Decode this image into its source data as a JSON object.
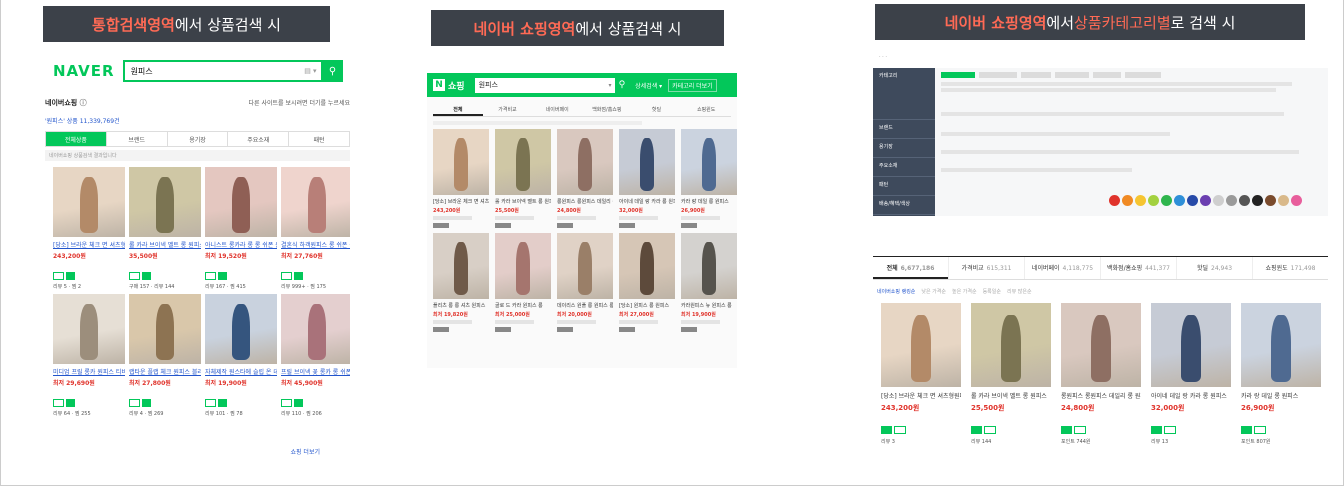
{
  "banners": [
    {
      "highlight1": "통합검색영역",
      "rest1": "에서 상품검색 시",
      "highlight2": "",
      "rest2": ""
    },
    {
      "highlight1": "네이버 쇼핑영역",
      "rest1": "에서 상품검색 시",
      "highlight2": "",
      "rest2": ""
    },
    {
      "highlight1": "네이버 쇼핑영역",
      "rest1": "에서 ",
      "highlight2": "상품카테고리별",
      "rest2": "로 검색 시"
    }
  ],
  "colors": {
    "naver_green": "#03c75a",
    "banner_bg": "#3c4149",
    "highlight": "#ff6a55",
    "price_red": "#e0332b"
  },
  "p1": {
    "logo": "NAVER",
    "query": "원피스",
    "section": "네이버쇼핑",
    "section_tip": "다른 사이트를 보시려면 더기를 누르세요",
    "result_count": "'원피스' 상품 11,339,769건",
    "tabs": [
      "전체상품",
      "브랜드",
      "용기장",
      "주요소재",
      "패턴"
    ],
    "notice": "네이버쇼핑 상품검색 결과입니다",
    "more": "쇼핑 더보기",
    "products": [
      {
        "title": "[당소] 브라운 체크 면 셔츠형원피...",
        "price": "243,200원",
        "meta": "리뷰 5 · 찜 2",
        "c1": "#e7d6c4",
        "c2": "#b38a68"
      },
      {
        "title": "롤 카라 브이넥 벨트 롱 원피스",
        "price": "35,500원",
        "meta": "구매 157 · 리뷰 144",
        "c1": "#cfc7a5",
        "c2": "#7b7452"
      },
      {
        "title": "아니스트 롱카라 롱 롱 쉬폰 원피...",
        "price": "최저 19,520원",
        "meta": "리뷰 167 · 찜 415",
        "c1": "#e4c7c0",
        "c2": "#8f5f55"
      },
      {
        "title": "결혼식 하객원피스 롱 쉬폰 롱 롱 원...",
        "price": "최저 27,760원",
        "meta": "리뷰 999+ · 찜 175",
        "c1": "#efd4cd",
        "c2": "#b87f78"
      },
      {
        "title": "미디엄 프릴 롱카 원피스 티비...",
        "price": "최저 29,690원",
        "meta": "리뷰 64 · 찜 255",
        "c1": "#e6dfd5",
        "c2": "#9c8e7c"
      },
      {
        "title": "랩타운 플랩 체크 원피스 블라...",
        "price": "최저 27,800원",
        "meta": "리뷰 4 · 찜 269",
        "c1": "#d9c7aa",
        "c2": "#8d7352"
      },
      {
        "title": "자체제작 원스타에 슬립 온 데비...",
        "price": "최저 19,900원",
        "meta": "리뷰 101 · 찜 78",
        "c1": "#c9d2de",
        "c2": "#35557e"
      },
      {
        "title": "프릴 브이넥 꽃 롱카 롱 쉬폰 미니...",
        "price": "최저 45,900원",
        "meta": "리뷰 110 · 찜 206",
        "c1": "#e4cfcf",
        "c2": "#a9727a"
      }
    ]
  },
  "p2": {
    "logo_n": "N",
    "logo_text": "쇼핑",
    "query": "원피스",
    "menu": "상세검색 ▾",
    "category_btn": "카테고리 더보기",
    "tabs": [
      "전체",
      "가격비교",
      "네이버페이",
      "백화점/홈쇼핑",
      "핫딜",
      "쇼핑윈도"
    ],
    "products": [
      {
        "title": "[당소] 브라운 체크 면 셔츠형원피스",
        "price": "243,200원",
        "c1": "#e7d6c4",
        "c2": "#b38a68"
      },
      {
        "title": "롤 카라 브이넥 벨트 롱 원피스",
        "price": "25,500원",
        "c1": "#cfc7a5",
        "c2": "#7b7452"
      },
      {
        "title": "롱원피스 롱원피스 데일리 원피스 롱",
        "price": "24,800원",
        "c1": "#d9c8bf",
        "c2": "#8e6f63"
      },
      {
        "title": "아이네 데일 랑 카라 롱 원피스",
        "price": "32,000원",
        "c1": "#c6cbd5",
        "c2": "#3a4d6e"
      },
      {
        "title": "카라 랑 데일 롱 원피스",
        "price": "26,900원",
        "c1": "#cbd3df",
        "c2": "#4f6a91"
      },
      {
        "title": "플리츠 롱 롱 셔츠 원피스",
        "price": "최저 19,820원",
        "c1": "#d8cfc6",
        "c2": "#6f5a49"
      },
      {
        "title": "골로 드 카라 원피스 롱",
        "price": "최저 25,000원",
        "c1": "#e3cdc9",
        "c2": "#a5756e"
      },
      {
        "title": "데이리스 원플 롱 원피스 롱",
        "price": "최저 20,000원",
        "c1": "#e0d2c6",
        "c2": "#9a7f68"
      },
      {
        "title": "[당소] 원피스 롱 원피스",
        "price": "최저 27,000원",
        "c1": "#d6c6b6",
        "c2": "#5d4a3b"
      },
      {
        "title": "카라원피스 뉴 원피스 롱",
        "price": "최저 19,900원",
        "c1": "#d4d2cf",
        "c2": "#56534d"
      }
    ]
  },
  "p3": {
    "tabs": [
      {
        "label": "전체",
        "count": "6,677,186"
      },
      {
        "label": "가격비교",
        "count": "615,311"
      },
      {
        "label": "네이버페이",
        "count": "4,118,775"
      },
      {
        "label": "백화점/홈쇼핑",
        "count": "441,377"
      },
      {
        "label": "핫딜",
        "count": "24,943"
      },
      {
        "label": "쇼핑윈도",
        "count": "171,498"
      }
    ],
    "sort_options": [
      "네이버쇼핑 랭킹순",
      "낮은 가격순",
      "높은 가격순",
      "등록일순",
      "리뷰 많은순"
    ],
    "filter_rows": [
      "카테고리",
      "브랜드",
      "용기장",
      "주요소재",
      "패턴",
      "배송/혜택/색상"
    ],
    "color_dots": [
      "#e0332b",
      "#f08a24",
      "#f6c531",
      "#a3d13f",
      "#2fb54d",
      "#2e8fd8",
      "#274aa8",
      "#6b3fb0",
      "#cfcfcf",
      "#9a9a9a",
      "#555555",
      "#222222",
      "#7a4b2d",
      "#d9b98a",
      "#e85e9c"
    ],
    "products": [
      {
        "title": "[당소] 브라운 체크 면 셔츠형원피스",
        "price": "243,200원",
        "meta": "리뷰 3",
        "c1": "#e7d6c4",
        "c2": "#b38a68"
      },
      {
        "title": "롤 카라 브이넥 벨트 롱 원피스",
        "price": "25,500원",
        "meta": "리뷰 144",
        "c1": "#cfc7a5",
        "c2": "#7b7452"
      },
      {
        "title": "롱원피스 롱원피스 데일리 롱 원피스",
        "price": "24,800원",
        "meta": "포인트 744원",
        "c1": "#d9c8bf",
        "c2": "#8e6f63"
      },
      {
        "title": "아이네 데일 랑 카라 롱 원피스",
        "price": "32,000원",
        "meta": "리뷰 13",
        "c1": "#c6cbd5",
        "c2": "#3a4d6e"
      },
      {
        "title": "카라 랑 데일 롱 원피스",
        "price": "26,900원",
        "meta": "포인트 807원",
        "c1": "#cbd3df",
        "c2": "#4f6a91"
      }
    ]
  }
}
